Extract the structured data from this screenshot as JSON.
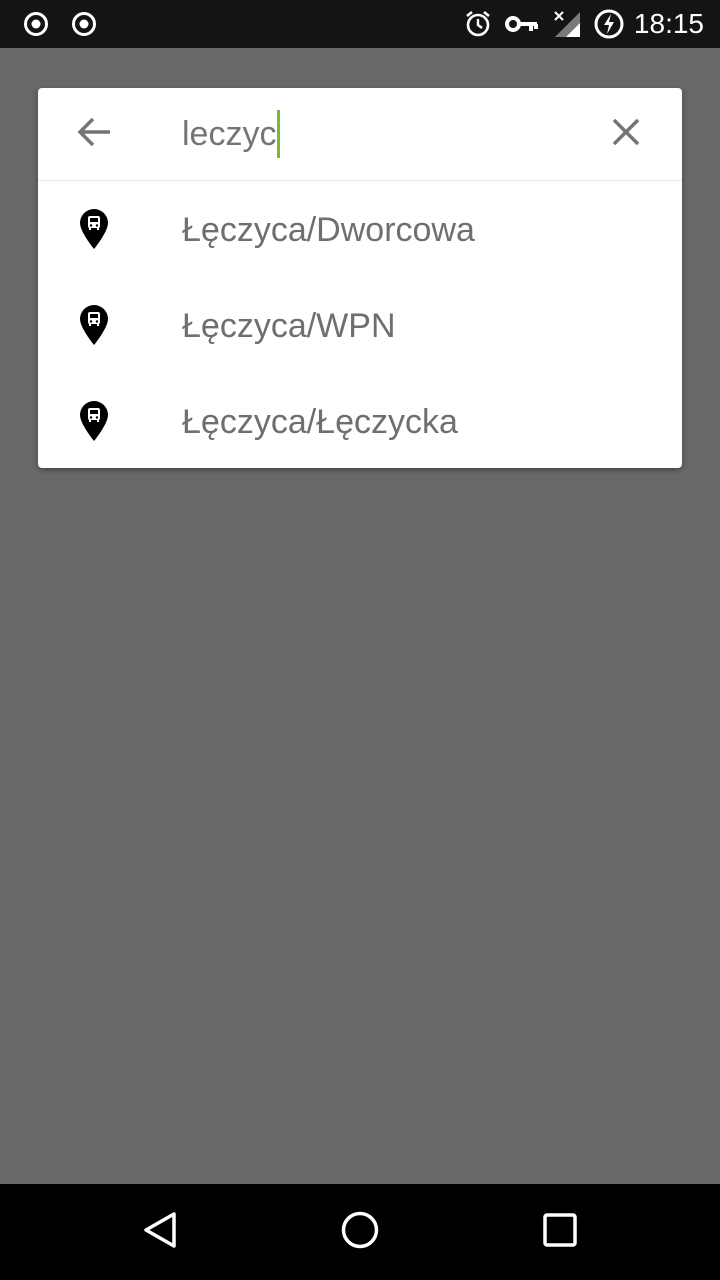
{
  "status_bar": {
    "time": "18:15",
    "left_icons": [
      "record-icon",
      "record-icon"
    ],
    "right_icons": [
      "alarm-icon",
      "vpn-key-icon",
      "signal-off-icon",
      "battery-charging-icon"
    ]
  },
  "search": {
    "value": "leczyc",
    "back_icon": "arrow-back-icon",
    "clear_icon": "close-icon"
  },
  "results": [
    {
      "label": "Łęczyca/Dworcowa",
      "icon": "bus-stop-pin-icon"
    },
    {
      "label": "Łęczyca/WPN",
      "icon": "bus-stop-pin-icon"
    },
    {
      "label": "Łęczyca/Łęczycka",
      "icon": "bus-stop-pin-icon"
    }
  ],
  "nav_bar": {
    "buttons": [
      "back-triangle-icon",
      "home-circle-icon",
      "recents-square-icon"
    ]
  },
  "colors": {
    "scrim": "#686868",
    "status_bar": "#141414",
    "caret": "#6fbf2f",
    "text": "#6f6f6f"
  }
}
